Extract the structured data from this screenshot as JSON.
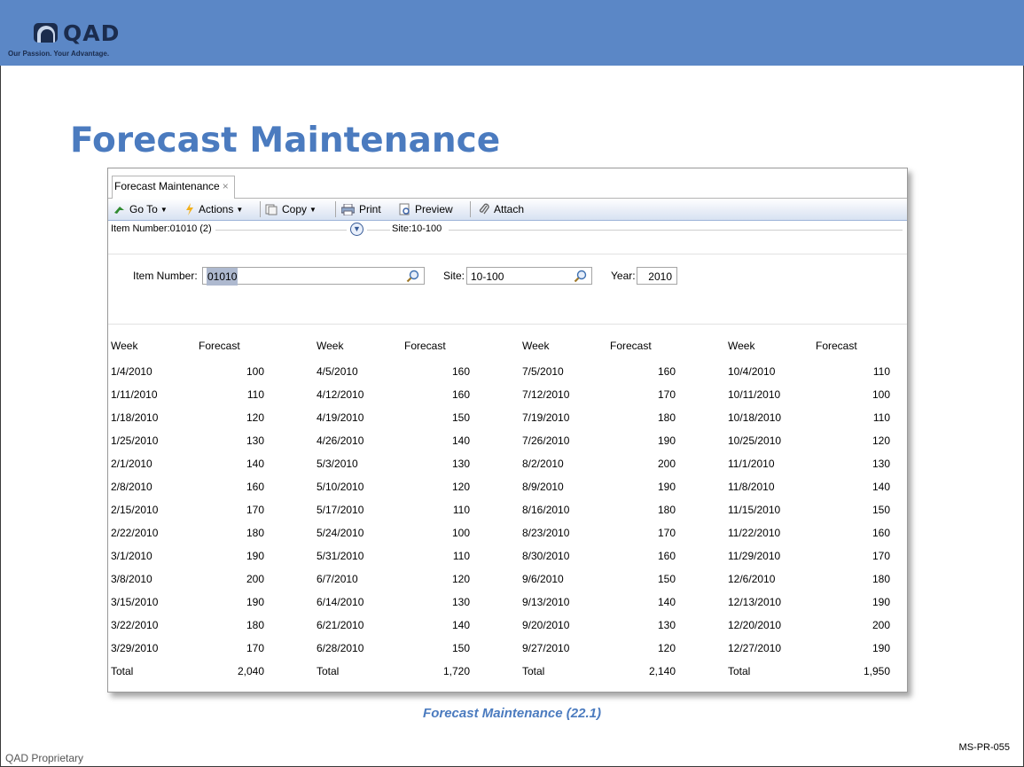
{
  "logo": {
    "text": "QAD",
    "tagline": "Our Passion. Your Advantage."
  },
  "slide": {
    "title": "Forecast Maintenance",
    "caption": "Forecast Maintenance (22.1)",
    "footer_left": "QAD Proprietary",
    "footer_right": "MS-PR-055"
  },
  "colors": {
    "banner": "#5b87c6",
    "title": "#4b7bbf",
    "toolbar": "#d7e2f2"
  },
  "tab": {
    "label": "Forecast Maintenance",
    "close": "×"
  },
  "toolbar": {
    "goto": "Go To",
    "actions": "Actions",
    "copy": "Copy",
    "print": "Print",
    "preview": "Preview",
    "attach": "Attach"
  },
  "summary": {
    "item": "Item Number:01010 (2)",
    "site": "Site:10-100"
  },
  "form": {
    "item_label": "Item Number:",
    "item_value": "01010",
    "site_label": "Site:",
    "site_value": "10-100",
    "year_label": "Year:",
    "year_value": "2010"
  },
  "grid": {
    "week_header": "Week",
    "forecast_header": "Forecast",
    "total_label": "Total",
    "quarters": [
      {
        "rows": [
          [
            "1/4/2010",
            "100"
          ],
          [
            "1/11/2010",
            "110"
          ],
          [
            "1/18/2010",
            "120"
          ],
          [
            "1/25/2010",
            "130"
          ],
          [
            "2/1/2010",
            "140"
          ],
          [
            "2/8/2010",
            "160"
          ],
          [
            "2/15/2010",
            "170"
          ],
          [
            "2/22/2010",
            "180"
          ],
          [
            "3/1/2010",
            "190"
          ],
          [
            "3/8/2010",
            "200"
          ],
          [
            "3/15/2010",
            "190"
          ],
          [
            "3/22/2010",
            "180"
          ],
          [
            "3/29/2010",
            "170"
          ]
        ],
        "total": "2,040"
      },
      {
        "rows": [
          [
            "4/5/2010",
            "160"
          ],
          [
            "4/12/2010",
            "160"
          ],
          [
            "4/19/2010",
            "150"
          ],
          [
            "4/26/2010",
            "140"
          ],
          [
            "5/3/2010",
            "130"
          ],
          [
            "5/10/2010",
            "120"
          ],
          [
            "5/17/2010",
            "110"
          ],
          [
            "5/24/2010",
            "100"
          ],
          [
            "5/31/2010",
            "110"
          ],
          [
            "6/7/2010",
            "120"
          ],
          [
            "6/14/2010",
            "130"
          ],
          [
            "6/21/2010",
            "140"
          ],
          [
            "6/28/2010",
            "150"
          ]
        ],
        "total": "1,720"
      },
      {
        "rows": [
          [
            "7/5/2010",
            "160"
          ],
          [
            "7/12/2010",
            "170"
          ],
          [
            "7/19/2010",
            "180"
          ],
          [
            "7/26/2010",
            "190"
          ],
          [
            "8/2/2010",
            "200"
          ],
          [
            "8/9/2010",
            "190"
          ],
          [
            "8/16/2010",
            "180"
          ],
          [
            "8/23/2010",
            "170"
          ],
          [
            "8/30/2010",
            "160"
          ],
          [
            "9/6/2010",
            "150"
          ],
          [
            "9/13/2010",
            "140"
          ],
          [
            "9/20/2010",
            "130"
          ],
          [
            "9/27/2010",
            "120"
          ]
        ],
        "total": "2,140"
      },
      {
        "rows": [
          [
            "10/4/2010",
            "110"
          ],
          [
            "10/11/2010",
            "100"
          ],
          [
            "10/18/2010",
            "110"
          ],
          [
            "10/25/2010",
            "120"
          ],
          [
            "11/1/2010",
            "130"
          ],
          [
            "11/8/2010",
            "140"
          ],
          [
            "11/15/2010",
            "150"
          ],
          [
            "11/22/2010",
            "160"
          ],
          [
            "11/29/2010",
            "170"
          ],
          [
            "12/6/2010",
            "180"
          ],
          [
            "12/13/2010",
            "190"
          ],
          [
            "12/20/2010",
            "200"
          ],
          [
            "12/27/2010",
            "190"
          ]
        ],
        "total": "1,950"
      }
    ]
  }
}
